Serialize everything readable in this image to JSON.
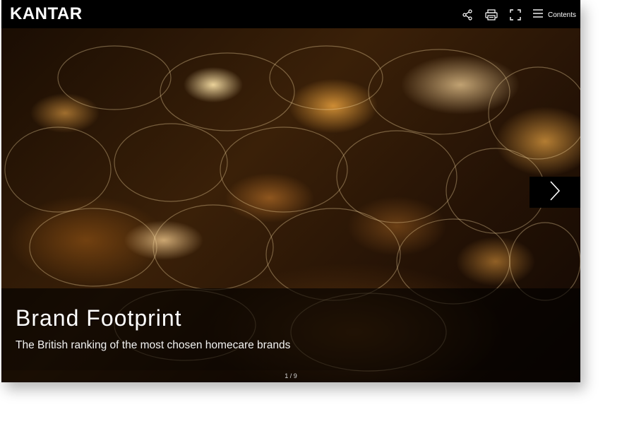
{
  "header": {
    "logo_text": "KANTAR",
    "icons": [
      "share-icon",
      "print-icon",
      "fullscreen-icon",
      "menu-icon"
    ],
    "contents_label": "Contents"
  },
  "slide": {
    "title": "Brand Footprint",
    "subtitle": "The British ranking of the most chosen homecare brands",
    "next_icon": "chevron-right-icon"
  },
  "pager": {
    "text": "1 / 9"
  },
  "colors": {
    "bar": "#000000",
    "text": "#ffffff",
    "accent": "#e8a040"
  }
}
